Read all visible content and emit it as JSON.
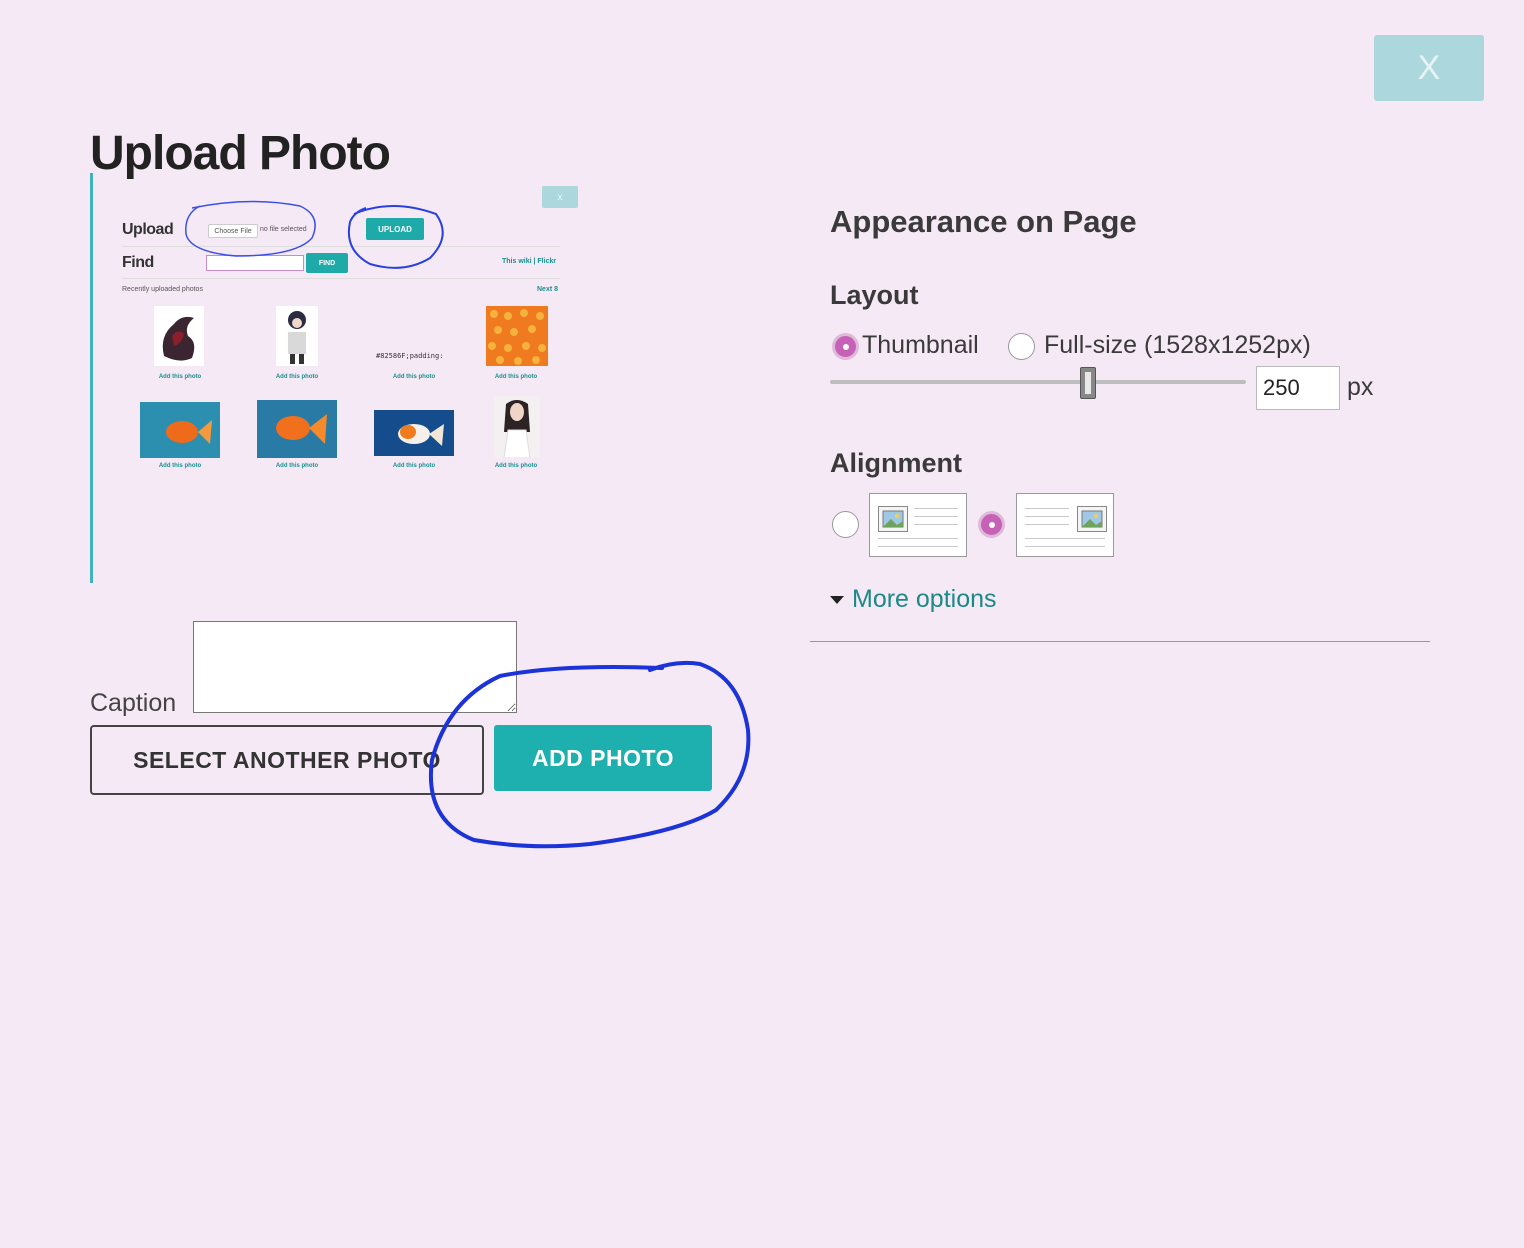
{
  "dialog": {
    "close_label": "X",
    "title": "Upload Photo"
  },
  "preview": {
    "close_label": "x",
    "upload_heading": "Upload",
    "choose_file_label": "Choose File",
    "no_file_text": "no file selected",
    "upload_button": "UPLOAD",
    "find_heading": "Find",
    "find_button": "FIND",
    "source_links": "This wiki | Flickr",
    "recent_label": "Recently uploaded photos",
    "next_label": "Next 8",
    "code_snippet": "#82586F;padding:",
    "add_photo_link": "Add this photo"
  },
  "caption": {
    "label": "Caption",
    "value": ""
  },
  "buttons": {
    "select_another": "SELECT ANOTHER PHOTO",
    "add_photo": "ADD PHOTO"
  },
  "appearance": {
    "title": "Appearance on Page",
    "layout_heading": "Layout",
    "layout_options": [
      "Thumbnail",
      "Full-size (1528x1252px)"
    ],
    "layout_selected": "Thumbnail",
    "size_value": "250",
    "size_unit": "px",
    "alignment_heading": "Alignment",
    "alignment_selected": "right",
    "more_options": "More options"
  },
  "colors": {
    "background": "#f6e9f6",
    "accent_teal": "#1eb0ae",
    "radio_selected": "#c760b7",
    "annotation_blue": "#1f3bdc"
  }
}
